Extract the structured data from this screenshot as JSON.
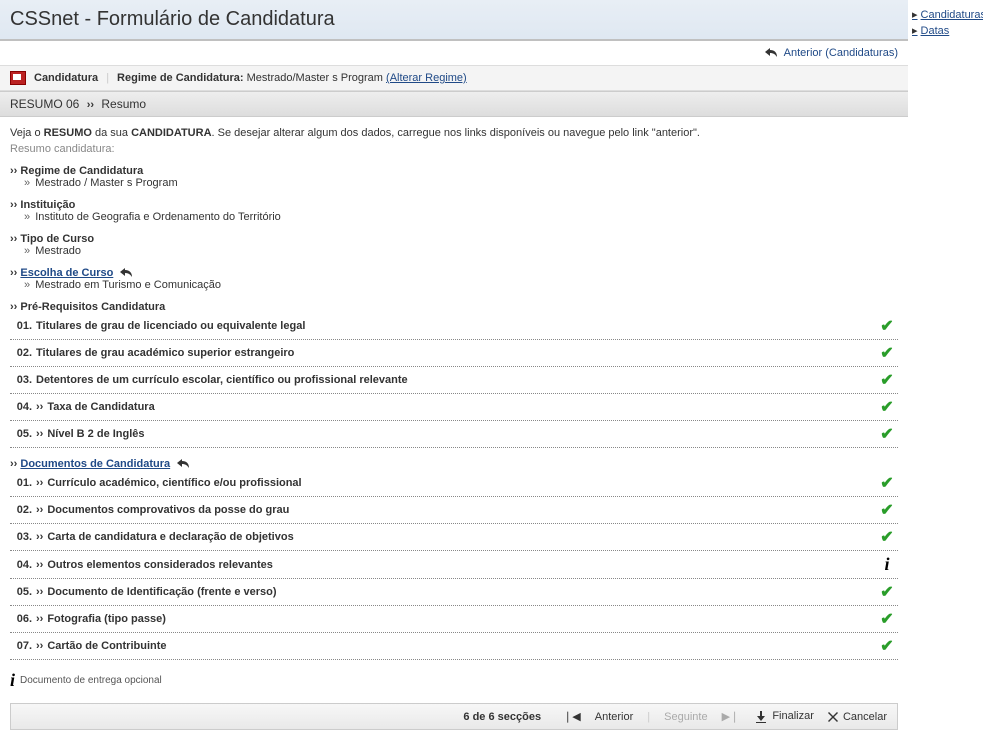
{
  "header": {
    "title": "CSSnet - Formulário de Candidatura"
  },
  "sidebar_links": {
    "candidaturas": "Candidaturas",
    "datas": "Datas"
  },
  "top_link": "Anterior (Candidaturas)",
  "breadcrumb": {
    "app": "Candidatura",
    "regime_label": "Regime de Candidatura:",
    "regime_value": "Mestrado/Master s Program",
    "change": "(Alterar Regime)"
  },
  "section": {
    "step": "RESUMO 06",
    "title": "Resumo"
  },
  "intro": {
    "p1a": "Veja o ",
    "p1b": "RESUMO",
    "p1c": " da sua ",
    "p1d": "CANDIDATURA",
    "p1e": ". Se desejar alterar algum dos dados, carregue nos links disponíveis ou navegue pelo link \"anterior\".",
    "sub": "Resumo candidatura:"
  },
  "items": {
    "regime": {
      "label": "Regime de Candidatura",
      "value": "Mestrado / Master s Program"
    },
    "inst": {
      "label": "Instituição",
      "value": "Instituto de Geografia e Ordenamento do Território"
    },
    "tipo": {
      "label": "Tipo de Curso",
      "value": "Mestrado"
    },
    "escolha": {
      "label": "Escolha de Curso",
      "value": "Mestrado em Turismo e Comunicação"
    }
  },
  "prereq": {
    "title": "Pré-Requisitos Candidatura",
    "rows": [
      {
        "n": "01.",
        "t": "Titulares de grau de licenciado ou equivalente legal",
        "chev": false,
        "s": "check"
      },
      {
        "n": "02.",
        "t": "Titulares de grau académico superior estrangeiro",
        "chev": false,
        "s": "check"
      },
      {
        "n": "03.",
        "t": "Detentores de um currículo escolar, científico ou profissional relevante",
        "chev": false,
        "s": "check"
      },
      {
        "n": "04.",
        "t": "Taxa de Candidatura",
        "chev": true,
        "s": "check"
      },
      {
        "n": "05.",
        "t": "Nível B 2 de Inglês",
        "chev": true,
        "s": "check"
      }
    ]
  },
  "docs": {
    "title": "Documentos de Candidatura",
    "rows": [
      {
        "n": "01.",
        "t": "Currículo académico, científico e/ou profissional",
        "s": "check"
      },
      {
        "n": "02.",
        "t": "Documentos comprovativos da posse do grau",
        "s": "check"
      },
      {
        "n": "03.",
        "t": "Carta de candidatura e declaração de objetivos",
        "s": "check"
      },
      {
        "n": "04.",
        "t": "Outros elementos considerados relevantes",
        "s": "info"
      },
      {
        "n": "05.",
        "t": "Documento de Identificação (frente e verso)",
        "s": "check"
      },
      {
        "n": "06.",
        "t": "Fotografia (tipo passe)",
        "s": "check"
      },
      {
        "n": "07.",
        "t": "Cartão de Contribuinte",
        "s": "check"
      }
    ]
  },
  "legend": "Documento de entrega opcional",
  "nav": {
    "counter": "6 de 6 secções",
    "prev": "Anterior",
    "next": "Seguinte",
    "finish": "Finalizar",
    "cancel": "Cancelar"
  }
}
